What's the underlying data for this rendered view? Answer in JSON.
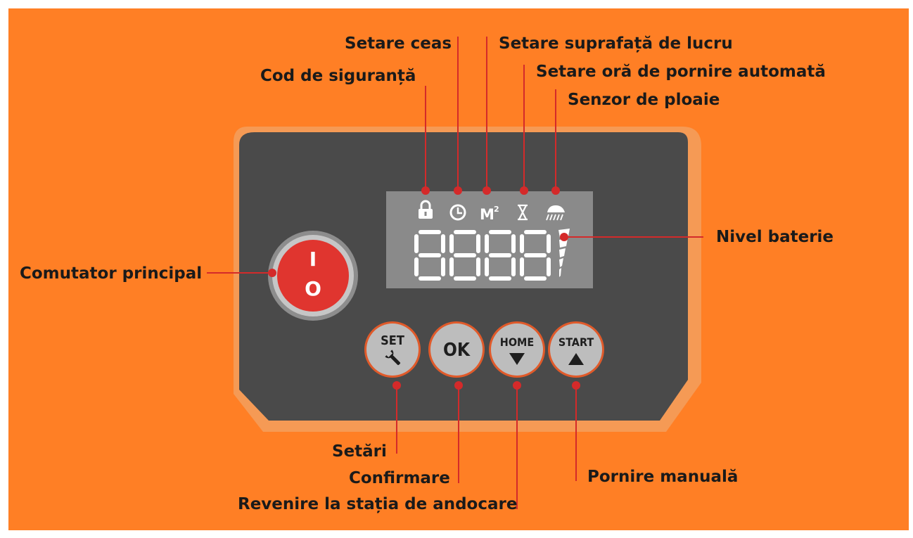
{
  "labels": {
    "setare_ceas": "Setare ceas",
    "setare_suprafata": "Setare suprafață de lucru",
    "cod_siguranta": "Cod de siguranță",
    "setare_ora": "Setare oră de pornire automată",
    "senzor_ploaie": "Senzor de ploaie",
    "nivel_baterie": "Nivel baterie",
    "comutator": "Comutator principal",
    "setari": "Setări",
    "confirmare": "Confirmare",
    "revenire": "Revenire la stația de andocare",
    "pornire_manuala": "Pornire manuală"
  },
  "power_switch": {
    "on_symbol": "I",
    "off_symbol": "O"
  },
  "lcd": {
    "area_icon": "M",
    "area_superscript": "2",
    "digits": [
      "8",
      "8",
      "8",
      "8"
    ]
  },
  "buttons": {
    "set": "SET",
    "ok": "OK",
    "home": "HOME",
    "start": "START"
  },
  "icons": [
    "lock-icon",
    "clock-icon",
    "area-icon",
    "hourglass-icon",
    "rain-icon",
    "battery-level-icon",
    "wrench-icon",
    "arrow-down-icon",
    "arrow-up-icon"
  ],
  "colors": {
    "background": "#ff7f25",
    "panel": "#4a4a4a",
    "panel_rim": "#f59a55",
    "lcd": "#8a8a8a",
    "switch_red": "#e0352f",
    "button_fill": "#bdbdbd",
    "leader_line": "#d42a2a"
  }
}
